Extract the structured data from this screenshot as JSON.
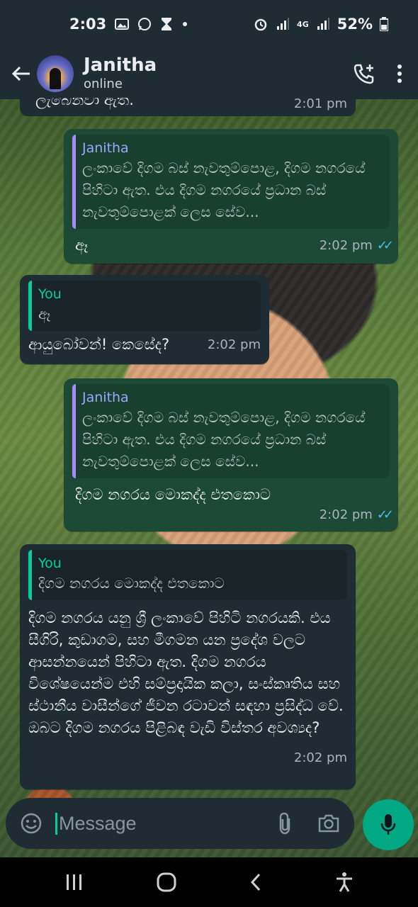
{
  "status_bar": {
    "time": "2:03",
    "battery": "52%",
    "network": "4G",
    "icons": [
      "gallery-icon",
      "whatsapp-icon",
      "hourglass-icon",
      "dot-icon",
      "alarm-icon",
      "signal-icon",
      "signal-icon",
      "battery-icon"
    ]
  },
  "header": {
    "contact_name": "Janitha",
    "contact_status": "online",
    "actions": [
      "add-call-icon",
      "more-options-icon"
    ]
  },
  "messages": [
    {
      "direction": "in",
      "text": "ලැබෙනවා ඇත.",
      "time": "2:01 pm"
    },
    {
      "direction": "out",
      "quote_author": "Janitha",
      "quote_text": "ලංකාවේ දිගම බස් නැවතුම්පොළ, දිගම නගරයේ පිහිටා ඇත. එය දිගම නගරයේ ප්‍රධාන බස් නැවතුම්පොළක් ලෙස සේව...",
      "text": "ඈ",
      "time": "2:02 pm",
      "read": true
    },
    {
      "direction": "in",
      "quote_author": "You",
      "quote_text": "ඈ",
      "text": "ආයුබෝවන්! කෙසේද?",
      "time": "2:02 pm"
    },
    {
      "direction": "out",
      "quote_author": "Janitha",
      "quote_text": "ලංකාවේ දිගම බස් නැවතුම්පොළ, දිගම නගරයේ පිහිටා ඇත. එය දිගම නගරයේ ප්‍රධාන බස් නැවතුම්පොළක් ලෙස සේව...",
      "text": "දිගම නගරය මොකද්ද එතකොට",
      "time": "2:02 pm",
      "read": true
    },
    {
      "direction": "in",
      "quote_author": "You",
      "quote_text": "දිගම නගරය මොකද්ද එතකොට",
      "text": "දිගම නගරය යනු ශ්‍රී ලංකාවේ පිහිටි නගරයකි. එය සීගිරි, කුඩාගම, සහ මීගමන යන ප්‍රදේශ වලට ආසන්නයෙන් පිහිටා ඇත. දිගම නගරය විශේෂයෙන්ම එහි සම්ප්‍රදායික කලා, සංස්කෘතිය සහ ස්ථානීය වාසීන්ගේ ජීවන රටාවන් සඳහා ප්‍රසිද්ධ වේ. ඔබට දිගම නගරය පිළිබඳ වැඩි විස්තර අවශ්‍යද?",
      "time": "2:02 pm"
    }
  ],
  "composer": {
    "placeholder": "Message",
    "icons": [
      "emoji-icon",
      "attach-icon",
      "camera-icon",
      "mic-icon"
    ]
  },
  "nav_bar": {
    "icons": [
      "recent-apps-icon",
      "home-icon",
      "back-icon",
      "accessibility-icon"
    ]
  },
  "colors": {
    "bar_bg": "#1f2c34",
    "incoming_bubble": "#202c33",
    "outgoing_bubble": "#1d4a36",
    "accent": "#00a884",
    "read_ticks": "#53bdeb"
  }
}
